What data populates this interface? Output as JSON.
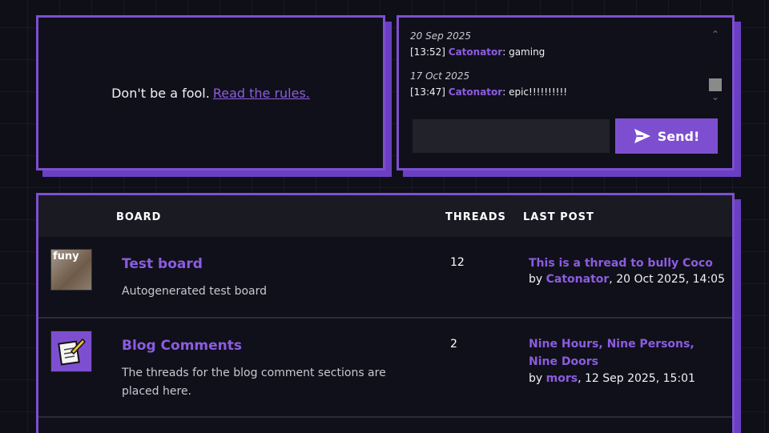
{
  "rules": {
    "text": "Don't be a fool.",
    "link": "Read the rules."
  },
  "chat": {
    "messages": [
      {
        "date": "20 Sep 2025",
        "time": "[13:52]",
        "user": "Catonator",
        "text": ": gaming"
      },
      {
        "date": "17 Oct 2025",
        "time": "[13:47]",
        "user": "Catonator",
        "text": ": epic!!!!!!!!!!"
      }
    ],
    "send_label": "Send!"
  },
  "boards": {
    "headers": {
      "board": "BOARD",
      "threads": "THREADS",
      "last_post": "LAST POST"
    },
    "rows": [
      {
        "thumb_label": "funy",
        "name": "Test board",
        "description": "Autogenerated test board",
        "threads": "12",
        "last_title": "This is a thread to bully Coco",
        "by": "by ",
        "user": "Catonator",
        "date": ", 20 Oct 2025, 14:05"
      },
      {
        "thumb_label": "",
        "name": "Blog Comments",
        "description": "The threads for the blog comment sections are placed here.",
        "threads": "2",
        "last_title": "Nine Hours, Nine Persons, Nine Doors",
        "by": "by ",
        "user": "mors",
        "date": ", 12 Sep 2025, 15:01"
      }
    ]
  }
}
